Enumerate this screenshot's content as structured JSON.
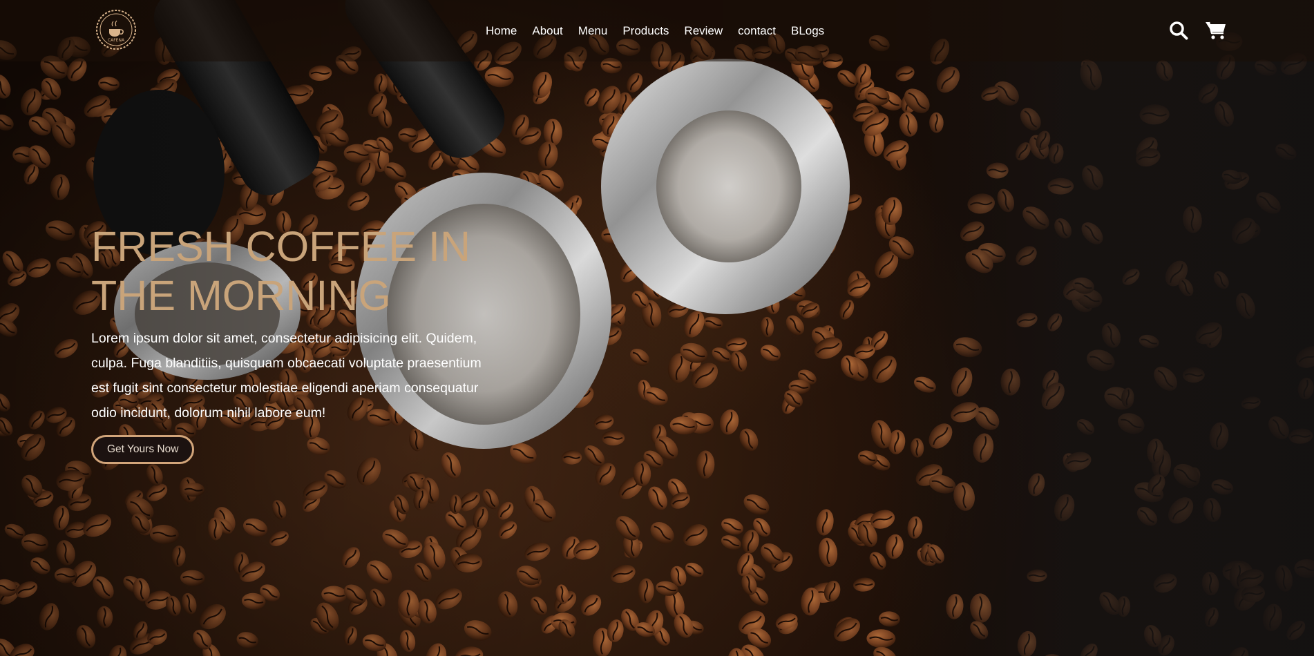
{
  "brand": {
    "logo_text": "CAFENA"
  },
  "nav": {
    "items": [
      {
        "label": "Home"
      },
      {
        "label": "About"
      },
      {
        "label": "Menu"
      },
      {
        "label": "Products"
      },
      {
        "label": "Review"
      },
      {
        "label": "contact"
      },
      {
        "label": "BLogs"
      }
    ]
  },
  "header_icons": {
    "search": "search-icon",
    "cart": "cart-icon"
  },
  "hero": {
    "title": "FRESH COFFEE IN THE MORNING",
    "text": "Lorem ipsum dolor sit amet, consectetur adipisicing elit. Quidem, culpa. Fuga blanditiis, quisquam obcaecati voluptate praesentium est fugit sint consectetur molestiae eligendi aperiam consequatur odio incidunt, dolorum nihil labore eum!",
    "button_label": "Get Yours Now"
  },
  "colors": {
    "accent": "#c9a47a",
    "button_bg": "#1c1210",
    "button_border": "#d2a57a",
    "header_bg": "#190e08"
  }
}
